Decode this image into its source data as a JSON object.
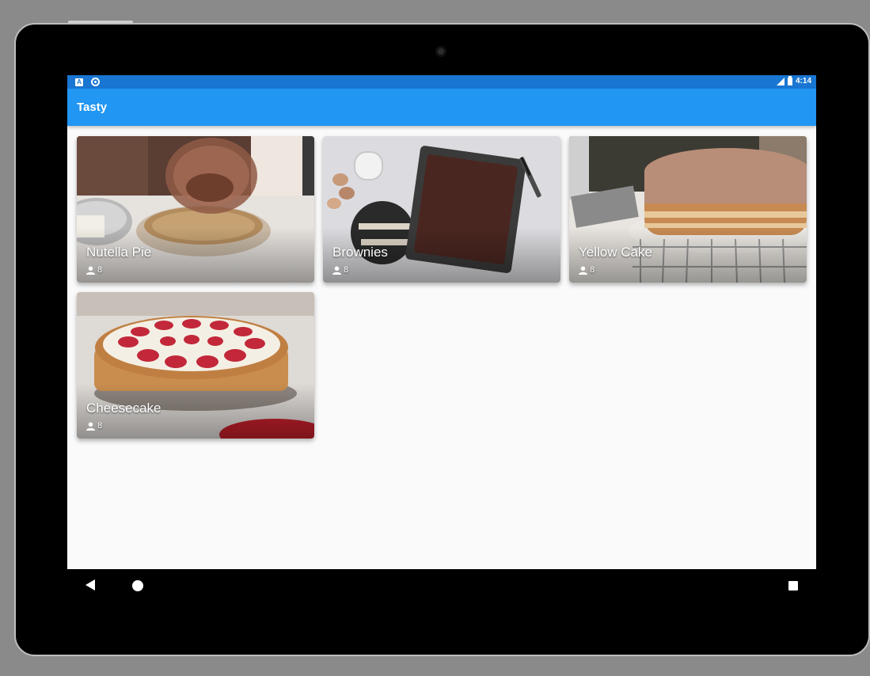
{
  "status_bar": {
    "time": "4:14",
    "notification_icons": [
      "a-icon",
      "circle-icon"
    ],
    "system_icons": [
      "signal-icon",
      "battery-icon"
    ],
    "color": "#1976d2"
  },
  "app_bar": {
    "title": "Tasty",
    "color": "#2196f3"
  },
  "recipes": [
    {
      "title": "Nutella Pie",
      "servings": "8",
      "image": "nutella-pie-photo"
    },
    {
      "title": "Brownies",
      "servings": "8",
      "image": "brownies-photo"
    },
    {
      "title": "Yellow Cake",
      "servings": "8",
      "image": "yellow-cake-photo"
    },
    {
      "title": "Cheesecake",
      "servings": "8",
      "image": "cheesecake-photo"
    }
  ],
  "nav_bar": {
    "icons": [
      "back-icon",
      "home-icon",
      "recents-icon"
    ]
  }
}
